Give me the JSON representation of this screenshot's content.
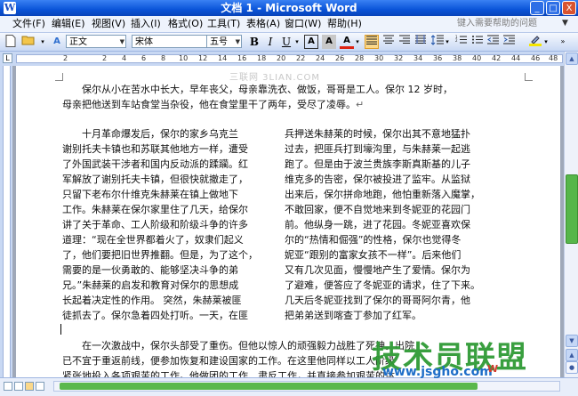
{
  "window": {
    "title": "文档 1 - Microsoft Word",
    "app_icon": "W",
    "buttons": {
      "minimize": "_",
      "maximize": "□",
      "close": "X"
    }
  },
  "menu": {
    "items": [
      "文件(F)",
      "编辑(E)",
      "视图(V)",
      "插入(I)",
      "格式(O)",
      "工具(T)",
      "表格(A)",
      "窗口(W)",
      "帮助(H)"
    ],
    "help_placeholder": "键入需要帮助的问题"
  },
  "toolbar": {
    "style": "正文",
    "font": "宋体",
    "size": "五号",
    "bold": "B",
    "italic": "I",
    "underline": "U",
    "char_border": "A",
    "char_shading": "A",
    "font_color": "A"
  },
  "ruler": {
    "tab_marker": "L",
    "numbers": [
      "2",
      "2",
      "4",
      "6",
      "8",
      "10",
      "12",
      "14",
      "16",
      "18",
      "20",
      "22",
      "24",
      "26",
      "28",
      "30",
      "32",
      "34",
      "36",
      "38",
      "40",
      "42",
      "44",
      "46",
      "48"
    ]
  },
  "document": {
    "intro": [
      "保尔从小在苦水中长大，早年丧父，母亲靠洗衣、做饭，哥哥是工人。保尔 12 岁时，",
      "母亲把他送到车站食堂当杂役，他在食堂里干了两年，受尽了凌辱。"
    ],
    "col_left": [
      "十月革命爆发后，保尔的家乡乌克兰",
      "谢别托夫卡镇也和苏联其他地方一样，遭受",
      "了外国武装干涉者和国内反动派的蹂躏。红",
      "军解放了谢别托夫卡镇，但很快就撤走了，",
      "只留下老布尔什维克朱赫莱在镇上做地下",
      "工作。朱赫莱在保尔家里住了几天，给保尔",
      "讲了关于革命、工人阶级和阶级斗争的许多",
      "道理：“现在全世界都着火了，奴隶们起义",
      "了，他们要把旧世界推翻。但是，为了这个，",
      "需要的是一伙勇敢的、能够坚决斗争的弟",
      "兄。”朱赫莱的启发和教育对保尔的思想成",
      "长起着决定性的作用。 突然，朱赫莱被匪",
      "徒抓去了。保尔急着四处打听。一天，在匪"
    ],
    "col_right": [
      "兵押送朱赫莱的时候，保尔出其不意地猛扑",
      "过去，把匪兵打到壕沟里，与朱赫莱一起逃",
      "跑了。但是由于波兰贵族李斯真斯基的儿子",
      "维克多的告密，保尔被投进了监牢。从监狱",
      "出来后，保尔拼命地跑，他怕重新落入魔掌，",
      "不敢回家，便不自觉地来到冬妮亚的花园门",
      "前。他纵身一跳，进了花园。冬妮亚喜欢保",
      "尔的“热情和倔强”的性格，保尔也觉得冬",
      "妮亚“跟别的富家女孩不一样”。后来他们",
      "又有几次见面，慢慢地产生了爱情。保尔为",
      "了避难，便答应了冬妮亚的请求，住了下来。",
      "几天后冬妮亚找到了保尔的哥哥阿尔青，他",
      "把弟弟送到喀查丁参加了红军。"
    ],
    "bottom": [
      "在一次激战中，保尔头部受了重伤。但他以惊人的顽强毅力战胜了死神。出院",
      "已不宜于重返前线，便参加恢复和建设国家的工作。在这里他同样以工人阶级",
      "紧张地投入各项艰苦的工作。他做团的工作、肃反工作，并直接参加艰苦的体"
    ],
    "paragraph_mark": "↵"
  },
  "watermarks": {
    "top": "三联网 3LIAN.COM",
    "logo": "技术员联盟",
    "url": "www.jsgho.com",
    "badge": "W"
  },
  "colors": {
    "title_bar": "#0a54d8",
    "scroll_thumb": "#56b64a",
    "watermark_green": "#2f9a35"
  }
}
